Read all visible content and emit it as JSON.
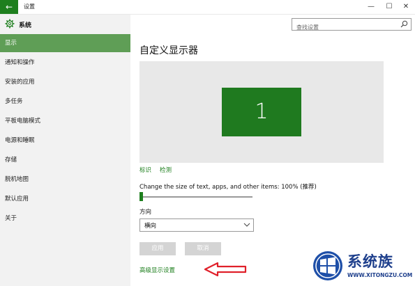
{
  "window": {
    "title": "设置",
    "back_glyph": "←",
    "minimize_glyph": "—",
    "maximize_glyph": "☐",
    "close_glyph": "✕"
  },
  "sidebar": {
    "header": "系统",
    "items": [
      {
        "label": "显示",
        "active": true
      },
      {
        "label": "通知和操作"
      },
      {
        "label": "安装的应用"
      },
      {
        "label": "多任务"
      },
      {
        "label": "平板电脑模式"
      },
      {
        "label": "电源和睡眠"
      },
      {
        "label": "存储"
      },
      {
        "label": "脱机地图"
      },
      {
        "label": "默认应用"
      },
      {
        "label": "关于"
      }
    ]
  },
  "search": {
    "placeholder": "查找设置"
  },
  "main": {
    "title": "自定义显示器",
    "monitor_number": "1",
    "identify_link": "标识",
    "detect_link": "检测",
    "scale_label": "Change the size of text, apps, and other items: 100% (推荐)",
    "scale_value": 0,
    "orientation_label": "方向",
    "orientation_value": "横向",
    "apply_button": "应用",
    "cancel_button": "取消",
    "advanced_link": "高级显示设置"
  },
  "watermark": {
    "brand": "系统族",
    "url": "WWW.XITONGZU.COM"
  },
  "colors": {
    "accent": "#1e7f1e",
    "sidebar_active": "#5f9e56",
    "annotation_arrow": "#e0202a"
  }
}
